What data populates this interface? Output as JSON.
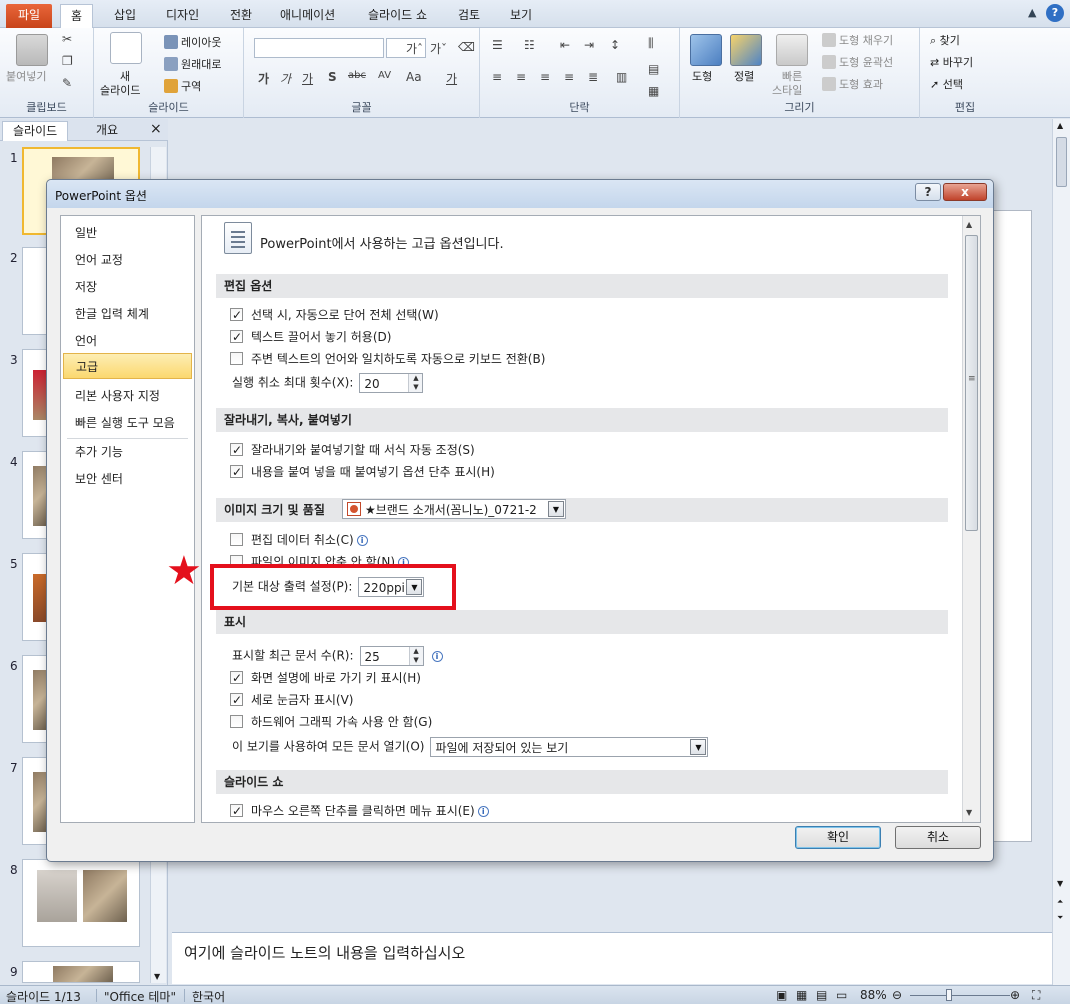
{
  "ribbon": {
    "tabs": [
      "파일",
      "홈",
      "삽입",
      "디자인",
      "전환",
      "애니메이션",
      "슬라이드 쇼",
      "검토",
      "보기"
    ],
    "groups": {
      "clipboard": {
        "label": "클립보드",
        "paste": "붙여넣기"
      },
      "slides": {
        "label": "슬라이드",
        "new_slide_line1": "새",
        "new_slide_line2": "슬라이드",
        "layout": "레이아웃",
        "reset": "원래대로",
        "section": "구역"
      },
      "font": {
        "label": "글꼴",
        "buttons": [
          "가",
          "가",
          "가",
          "S",
          "abc",
          "AV",
          "Aa",
          "가"
        ]
      },
      "paragraph": {
        "label": "단락"
      },
      "drawing": {
        "label": "그리기",
        "shapes": "도형",
        "arrange": "정렬",
        "quick_style_line1": "빠른",
        "quick_style_line2": "스타일",
        "fill": "도형 채우기",
        "outline": "도형 윤곽선",
        "effects": "도형 효과"
      },
      "editing": {
        "label": "편집",
        "find": "찾기",
        "replace": "바꾸기",
        "select": "선택"
      }
    }
  },
  "left_panel": {
    "tabs": [
      "슬라이드",
      "개요"
    ],
    "close": "×",
    "slide_numbers": [
      "1",
      "2",
      "3",
      "4",
      "5",
      "6",
      "7",
      "8",
      "9"
    ]
  },
  "notes_placeholder": "여기에 슬라이드 노트의 내용을 입력하십시오",
  "status_bar": {
    "slide_info": "슬라이드 1/13",
    "theme": "\"Office 테마\"",
    "language": "한국어",
    "zoom": "88%"
  },
  "dialog": {
    "title": "PowerPoint 옵션",
    "help": "?",
    "close": "x",
    "nav": [
      "일반",
      "언어 교정",
      "저장",
      "한글 입력 체계",
      "언어",
      "고급",
      "리본 사용자 지정",
      "빠른 실행 도구 모음",
      "추가 기능",
      "보안 센터"
    ],
    "selected_nav": "고급",
    "header": "PowerPoint에서 사용하는 고급 옵션입니다.",
    "sections": {
      "editing": {
        "title": "편집 옵션",
        "opt1": "선택 시, 자동으로 단어 전체 선택(W)",
        "opt2": "텍스트 끌어서 놓기 허용(D)",
        "opt3": "주변 텍스트의 언어와 일치하도록 자동으로 키보드 전환(B)",
        "undo_label": "실행 취소 최대 횟수(X):",
        "undo_value": "20"
      },
      "cut_copy_paste": {
        "title": "잘라내기, 복사, 붙여넣기",
        "opt1": "잘라내기와 붙여넣기할 때 서식 자동 조정(S)",
        "opt2": "내용을 붙여 넣을 때 붙여넣기 옵션 단추 표시(H)"
      },
      "image": {
        "title": "이미지 크기 및 품질",
        "file": "★브랜드 소개서(꼼니노)_0721-2",
        "opt1": "편집 데이터 취소(C)",
        "opt2": "파일의 이미지 압축 안 함(N)",
        "output_label": "기본 대상 출력 설정(P):",
        "output_value": "220ppi"
      },
      "display": {
        "title": "표시",
        "recent_label": "표시할 최근 문서 수(R):",
        "recent_value": "25",
        "opt1": "화면 설명에 바로 가기 키 표시(H)",
        "opt2": "세로 눈금자 표시(V)",
        "opt3": "하드웨어 그래픽 가속 사용 안 함(G)",
        "open_label": "이 보기를 사용하여 모든 문서 열기(O)",
        "open_value": "파일에 저장되어 있는 보기"
      },
      "slideshow": {
        "title": "슬라이드 쇼",
        "opt1": "마우스 오른쪽 단추를 클릭하면 메뉴 표시(E)"
      }
    },
    "ok": "확인",
    "cancel": "취소"
  },
  "annotation": {
    "star": "★"
  },
  "colors": {
    "accent_red": "#e4101c",
    "file_tab": "#d2521f",
    "selection": "#fbd86f"
  }
}
